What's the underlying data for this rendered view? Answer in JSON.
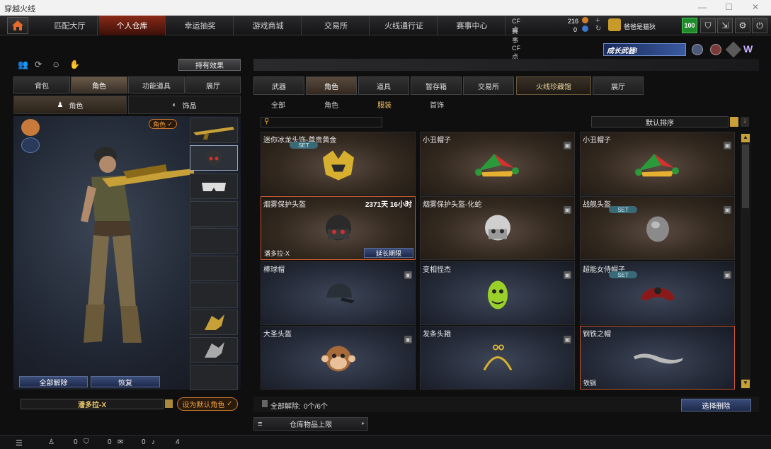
{
  "window": {
    "title": "穿越火线"
  },
  "nav": {
    "tabs": [
      "匹配大厅",
      "个人仓库",
      "幸运抽奖",
      "游戏商城",
      "交易所",
      "火线通行证",
      "赛事中心"
    ],
    "active_index": 1
  },
  "currency": {
    "cf_label": "CF点",
    "cf_value": "216",
    "event_label": "赛事CF点",
    "event_value": "0"
  },
  "user": {
    "name": "爸爸是猫狄",
    "level": "100"
  },
  "banner": {
    "text": "成长武器!"
  },
  "left": {
    "effect_button": "持有效果",
    "tabs": [
      "背包",
      "角色",
      "功能道具",
      "展厅"
    ],
    "active_tab": 1,
    "subtabs": [
      "角色",
      "饰品"
    ],
    "role_badge": "角色",
    "unequip_all": "全部解除",
    "restore": "恢复",
    "character_name": "潘多拉-X",
    "set_default": "设为默认角色"
  },
  "right": {
    "tabs": [
      "武器",
      "角色",
      "道具",
      "暂存箱",
      "交易所",
      "火线珍藏馆",
      "展厅"
    ],
    "active_tab": 1,
    "subtabs": [
      "全部",
      "角色",
      "服装",
      "首饰"
    ],
    "active_sub": 2,
    "sort_label": "默认排序",
    "items": [
      {
        "name": "迷你冰龙头饰-尊贵黄金",
        "set": "SET",
        "style": "warm",
        "icon": "gold-helmet-icon"
      },
      {
        "name": "小丑帽子",
        "style": "warm",
        "icon": "jester-hat-icon",
        "locked": true
      },
      {
        "name": "小丑帽子",
        "style": "warm",
        "icon": "jester-hat-icon",
        "locked": true
      },
      {
        "name": "烟雾保护头盔",
        "duration": "2371天 16小时",
        "footer": "潘多拉-X",
        "action": "延长期限",
        "style": "warm",
        "highlight": true,
        "icon": "gas-mask-helmet-icon"
      },
      {
        "name": "烟雾保护头盔-化蛇",
        "style": "warm",
        "icon": "white-gas-mask-icon",
        "locked": true
      },
      {
        "name": "战舰头盔",
        "set": "SET",
        "style": "warm",
        "icon": "warship-helmet-icon",
        "locked": true
      },
      {
        "name": "棒球帽",
        "style": "cool",
        "icon": "baseball-cap-icon",
        "locked": true
      },
      {
        "name": "变相怪杰",
        "style": "cool",
        "icon": "green-mask-icon",
        "locked": true
      },
      {
        "name": "超能女侍帽子",
        "set": "SET",
        "style": "cool",
        "icon": "maid-headband-icon",
        "locked": true
      },
      {
        "name": "大圣头盔",
        "style": "cool",
        "icon": "monkey-head-icon",
        "locked": true
      },
      {
        "name": "发条头箍",
        "style": "cool",
        "icon": "wind-up-headband-icon",
        "locked": true
      },
      {
        "name": "钢铁之帽",
        "footer": "铁锅",
        "style": "cool",
        "highlight": true,
        "icon": "iron-hat-icon"
      }
    ],
    "unequip_count_label": "全部解除:",
    "unequip_count": "0个/6个",
    "select_delete": "选择删除",
    "storage_limit": "仓库物品上限"
  },
  "status": {
    "friends": "0",
    "guild": "0",
    "chat": "0",
    "volume": "4"
  }
}
